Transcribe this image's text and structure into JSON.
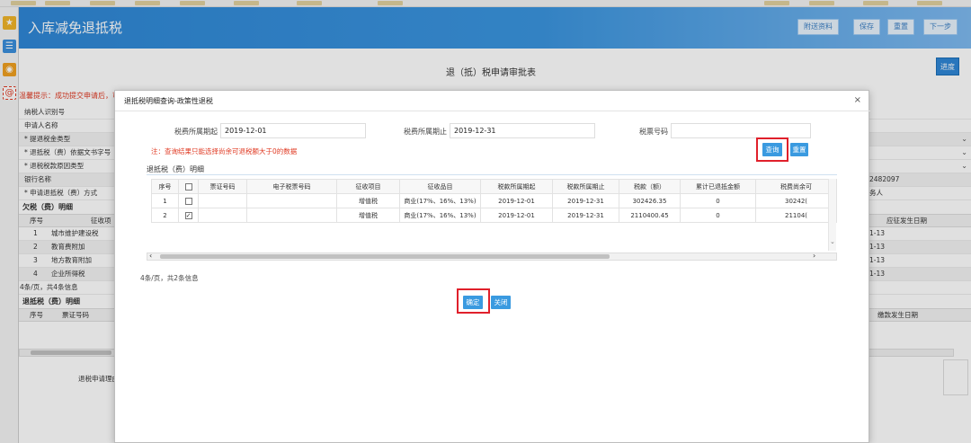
{
  "header": {
    "title": "入库减免退抵税",
    "buttons": [
      "附送资料",
      "保存",
      "重置",
      "下一步"
    ]
  },
  "page": {
    "title": "退（抵）税申请审批表",
    "progress_label": "进度",
    "hint": "温馨提示：成功提交申请后，可",
    "left_labels": [
      "纳税人识别号",
      "申请人名称",
      "* 提退税金类型",
      "* 退抵税（费）依据文书字号",
      "* 退税税款原因类型",
      "银行名称",
      "* 申请退抵税（费）方式"
    ],
    "right_values": [
      "",
      "",
      "",
      "",
      "",
      "2482097",
      "务人"
    ],
    "owed_section": "欠税（费）明细",
    "owed_head": [
      "序号",
      "征收项",
      "应征发生日期"
    ],
    "owed_rows": [
      {
        "no": "1",
        "item": "城市维护建设税",
        "date": "1-13"
      },
      {
        "no": "2",
        "item": "教育费附加",
        "date": "1-13"
      },
      {
        "no": "3",
        "item": "地方教育附加",
        "date": "1-13"
      },
      {
        "no": "4",
        "item": "企业所得税",
        "date": "1-13"
      }
    ],
    "owed_pager": "4条/页，共4条信息",
    "refund_section": "退抵税（费）明细",
    "refund_head": [
      "序号",
      "票证号码",
      "缴款发生日期"
    ],
    "reason_label": "退税申请理由"
  },
  "modal": {
    "title": "退抵税明细查询-政策性退税",
    "close": "×",
    "period_start_label": "税费所属期起",
    "period_start_value": "2019-12-01",
    "period_end_label": "税费所属期止",
    "period_end_value": "2019-12-31",
    "ticket_label": "税票号码",
    "ticket_value": "",
    "note": "注：查询结果只能选择尚余可退税额大于0的数据",
    "query_label": "查询",
    "reset_label": "重置",
    "section_title": "退抵税（费）明细",
    "columns": [
      "序号",
      "",
      "票证号码",
      "电子税票号码",
      "征收项目",
      "征收品目",
      "税款所属期起",
      "税款所属期止",
      "税款（额）",
      "累计已退抵金额",
      "税费尚余可"
    ],
    "rows": [
      {
        "no": "1",
        "checked": false,
        "ticket": "",
        "eticket": "",
        "item": "增值税",
        "subitem": "商业(17%、16%、13%)",
        "start": "2019-12-01",
        "end": "2019-12-31",
        "amount": "302426.35",
        "refunded": "0",
        "remain": "30242("
      },
      {
        "no": "2",
        "checked": true,
        "ticket": "",
        "eticket": "",
        "item": "增值税",
        "subitem": "商业(17%、16%、13%)",
        "start": "2019-12-01",
        "end": "2019-12-31",
        "amount": "2110400.45",
        "refunded": "0",
        "remain": "21104("
      }
    ],
    "pager": "4条/页，共2条信息",
    "confirm_label": "确定",
    "close_label": "关闭"
  },
  "colors": {
    "accent": "#3a9ae0",
    "highlight": "#e0202b",
    "warning_text": "#e03b24"
  }
}
